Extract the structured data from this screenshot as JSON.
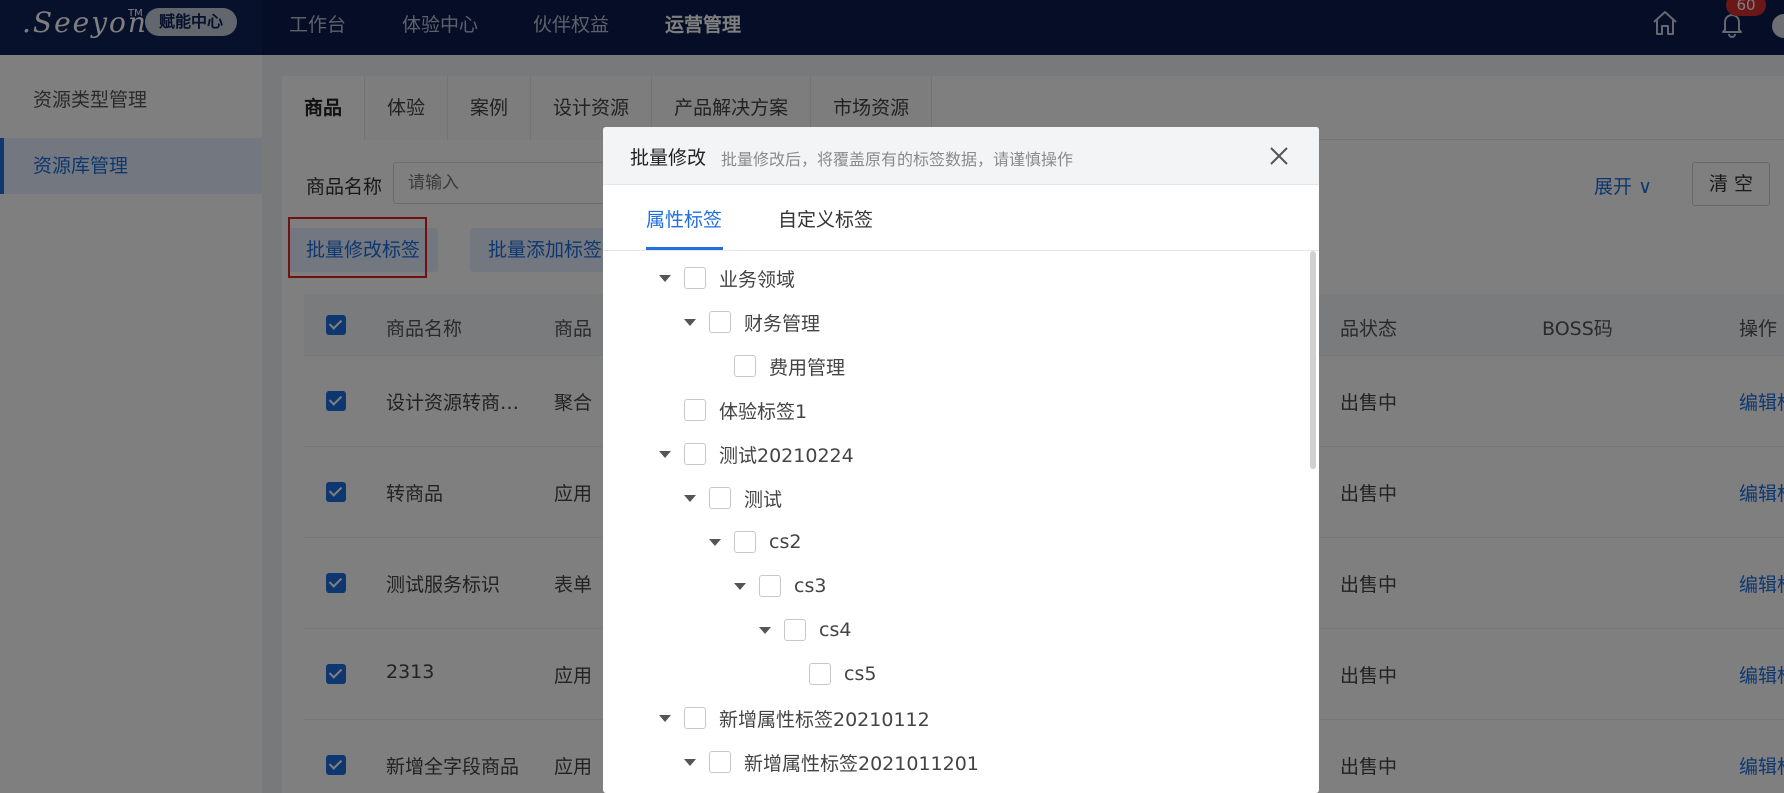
{
  "header": {
    "logo_text": ".Seeyon",
    "logo_tm": "TM",
    "logo_badge": "赋能中心",
    "nav": [
      "工作台",
      "体验中心",
      "伙伴权益",
      "运营管理"
    ],
    "notif_count": "60"
  },
  "sidebar": {
    "items": [
      "资源类型管理",
      "资源库管理"
    ]
  },
  "main": {
    "tabs": [
      "商品",
      "体验",
      "案例",
      "设计资源",
      "产品解决方案",
      "市场资源"
    ],
    "filter_label": "商品名称",
    "filter_placeholder": "请输入",
    "expand": "展开",
    "clear": "清 空",
    "btn_batch_edit": "批量修改标签",
    "btn_batch_add": "批量添加标签",
    "columns": [
      "商品名称",
      "商品",
      "品状态",
      "BOSS码",
      "操作"
    ],
    "rows": [
      {
        "name": "设计资源转商…",
        "type": "聚合",
        "status": "出售中",
        "action": "编辑标签"
      },
      {
        "name": "转商品",
        "type": "应用",
        "status": "出售中",
        "action": "编辑标签"
      },
      {
        "name": "测试服务标识",
        "type": "表单",
        "status": "出售中",
        "action": "编辑标签"
      },
      {
        "name": "2313",
        "type": "应用",
        "status": "出售中",
        "action": "编辑标签"
      },
      {
        "name": "新增全字段商品",
        "type": "应用",
        "status": "出售中",
        "action": "编辑标签"
      }
    ]
  },
  "modal": {
    "title": "批量修改",
    "subtitle": "批量修改后，将覆盖原有的标签数据，请谨慎操作",
    "tabs": [
      "属性标签",
      "自定义标签"
    ],
    "tree": [
      {
        "label": "业务领域",
        "level": 0,
        "expandable": true
      },
      {
        "label": "财务管理",
        "level": 1,
        "expandable": true
      },
      {
        "label": "费用管理",
        "level": 2,
        "expandable": false
      },
      {
        "label": "体验标签1",
        "level": 0,
        "expandable": false
      },
      {
        "label": "测试20210224",
        "level": 0,
        "expandable": true
      },
      {
        "label": "测试",
        "level": 1,
        "expandable": true
      },
      {
        "label": "cs2",
        "level": 2,
        "expandable": true
      },
      {
        "label": "cs3",
        "level": 3,
        "expandable": true
      },
      {
        "label": "cs4",
        "level": 4,
        "expandable": true
      },
      {
        "label": "cs5",
        "level": 5,
        "expandable": false
      },
      {
        "label": "新增属性标签20210112",
        "level": 0,
        "expandable": true
      },
      {
        "label": "新增属性标签2021011201",
        "level": 1,
        "expandable": true
      }
    ]
  },
  "colors": {
    "header_bg": "#0b1d4d",
    "accent": "#1f6fde",
    "highlight_box": "#e02020"
  }
}
